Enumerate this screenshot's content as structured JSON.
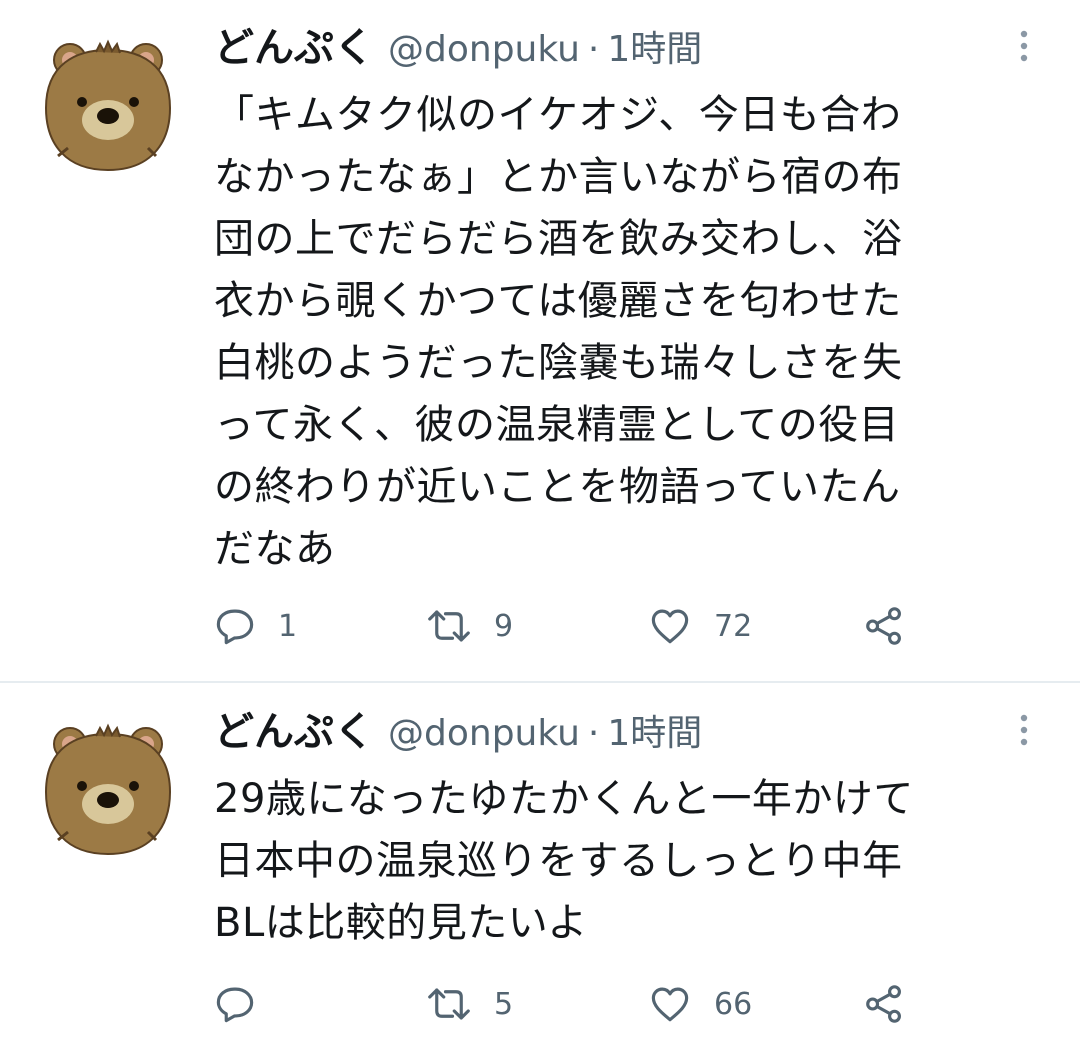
{
  "tweets": [
    {
      "display_name": "どんぷく",
      "handle": "@donpuku",
      "separator": "·",
      "time": "1時間",
      "text": "「キムタク似のイケオジ、今日も合わ\nなかったなぁ」とか言いながら宿の布\n団の上でだらだら酒を飲み交わし、浴\n衣から覗くかつては優麗さを匂わせた\n白桃のようだった陰嚢も瑞々しさを失\nって永く、彼の温泉精霊としての役目\nの終わりが近いことを物語っていたん\nだなあ",
      "avatar_icon": "bear-avatar-icon",
      "actions": {
        "reply_count": "1",
        "retweet_count": "9",
        "like_count": "72"
      }
    },
    {
      "display_name": "どんぷく",
      "handle": "@donpuku",
      "separator": "·",
      "time": "1時間",
      "text": "29歳になったゆたかくんと一年かけて\n日本中の温泉巡りをするしっとり中年\nBLは比較的見たいよ",
      "avatar_icon": "bear-avatar-icon",
      "actions": {
        "reply_count": "",
        "retweet_count": "5",
        "like_count": "66"
      }
    }
  ],
  "colors": {
    "text": "#14171a",
    "secondary": "#536471",
    "divider": "#e6ecf0",
    "bear_fur": "#9c7a45",
    "bear_outline": "#5a4022"
  },
  "icons": {
    "reply": "reply-icon",
    "retweet": "retweet-icon",
    "like": "heart-icon",
    "share": "share-icon",
    "more": "more-vertical-icon"
  }
}
